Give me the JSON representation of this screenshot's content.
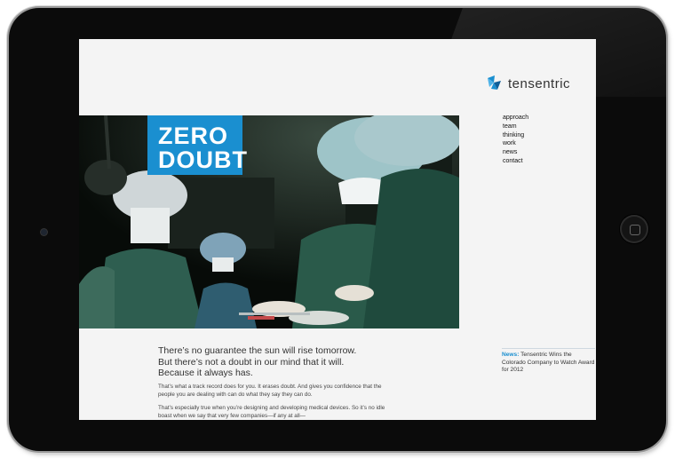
{
  "brand": {
    "name": "tensentric"
  },
  "nav": {
    "items": [
      "approach",
      "team",
      "thinking",
      "work",
      "news",
      "contact"
    ]
  },
  "hero": {
    "badge_line1": "ZERO",
    "badge_line2": "DOUBT",
    "image_desc": "surgeons-in-operating-room-photo"
  },
  "content": {
    "headline_lines": [
      "There’s no guarantee the sun will rise tomorrow.",
      "But there’s not a doubt in our mind that it will.",
      "Because it always has."
    ],
    "paragraph1": "That’s what a track record does for you. It erases doubt. And gives you confidence that the people you are dealing with can do what they say they can do.",
    "paragraph2": "That’s especially true when you’re designing and developing medical devices. So it’s no idle boast when we say that very few companies—if any at all—"
  },
  "news": {
    "label": "News:",
    "text": "Tensentric Wins the Colorado Company to Watch Award for 2012"
  },
  "colors": {
    "accent": "#1a8fd0",
    "bezel": "#0b0b0b",
    "page_bg": "#f4f4f4"
  }
}
